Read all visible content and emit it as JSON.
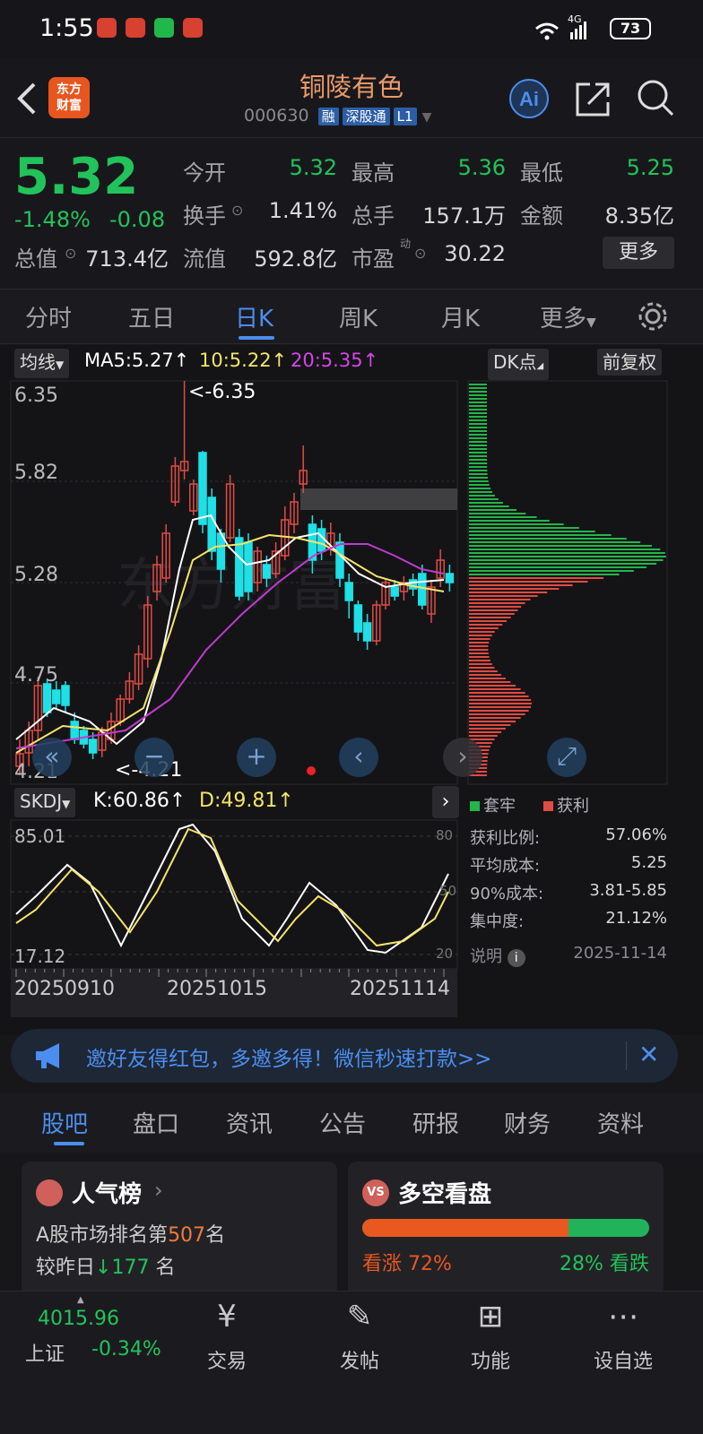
{
  "status": {
    "time": "1:55",
    "network": "4G",
    "battery": "73"
  },
  "header": {
    "logo": "东方\n财富",
    "title": "铜陵有色",
    "code": "000630",
    "tags": [
      "融",
      "深股通",
      "L1"
    ],
    "icons": [
      "back-icon",
      "ai-icon",
      "share-icon",
      "search-icon"
    ]
  },
  "quote": {
    "price": "5.32",
    "change_pct": "-1.48%",
    "change": "-0.08",
    "rows": [
      [
        {
          "label": "今开",
          "value": "5.32"
        },
        {
          "label": "最高",
          "value": "5.36"
        },
        {
          "label": "最低",
          "value": "5.25"
        }
      ],
      [
        {
          "label": "换手",
          "value": "1.41%"
        },
        {
          "label": "总手",
          "value": "157.1万"
        },
        {
          "label": "金额",
          "value": "8.35亿"
        }
      ],
      [
        {
          "label": "总值",
          "value": "713.4亿"
        },
        {
          "label": "流值",
          "value": "592.8亿"
        },
        {
          "label": "市盈",
          "value": "30.22"
        }
      ]
    ],
    "pe_superscript": "动",
    "more_label": "更多"
  },
  "ktabs": [
    "分时",
    "五日",
    "日K",
    "周K",
    "月K",
    "更多"
  ],
  "chart": {
    "ma_chip": "均线",
    "ma5": "MA5:5.27↑",
    "ma10": "10:5.22↑",
    "ma20": "20:5.35↑",
    "dk_chip": "DK点",
    "fq_chip": "前复权",
    "yticks": [
      "6.35",
      "5.82",
      "5.28",
      "4.75",
      "4.21"
    ],
    "high_label": "<-6.35",
    "low_label": "<-4.21",
    "skdj_chip": "SKDJ",
    "k": "K:60.86↑",
    "d": "D:49.81↑",
    "skdj_top": "85.01",
    "skdj_bottom": "17.12",
    "skdj_right": [
      "80",
      "50",
      "20"
    ],
    "dates": [
      "20250910",
      "20251015",
      "20251114"
    ],
    "colors": {
      "up": "#e24b43",
      "down": "#1ee0e6",
      "ma5": "#ffffff",
      "ma10": "#f4e46a",
      "ma20": "#c03ad1"
    }
  },
  "chip_panel": {
    "legend_trap": "套牢",
    "legend_profit": "获利",
    "rows": [
      {
        "label": "获利比例:",
        "value": "57.06%"
      },
      {
        "label": "平均成本:",
        "value": "5.25"
      },
      {
        "label": "90%成本:",
        "value": "3.81-5.85"
      },
      {
        "label": "集中度:",
        "value": "21.12%"
      }
    ],
    "note": "说明",
    "date": "2025-11-14"
  },
  "banner": {
    "text": "邀好友得红包，多邀多得！微信秒速打款>>"
  },
  "btabs": [
    "股吧",
    "盘口",
    "资讯",
    "公告",
    "研报",
    "财务",
    "资料"
  ],
  "popularity": {
    "title": "人气榜",
    "line1_pre": "A股市场排名第",
    "rank": "507",
    "line1_post": "名",
    "line2_pre": "较昨日",
    "delta": "177",
    "line2_post": "名"
  },
  "sentiment": {
    "title": "多空看盘",
    "up_label": "看涨",
    "up_pct": "72%",
    "down_pct": "28%",
    "down_label": "看跌",
    "up_ratio": 0.72
  },
  "nav": {
    "index_value": "4015.96",
    "index_name": "上证",
    "index_change": "-0.34%",
    "items": [
      "交易",
      "发帖",
      "功能",
      "设自选"
    ]
  }
}
